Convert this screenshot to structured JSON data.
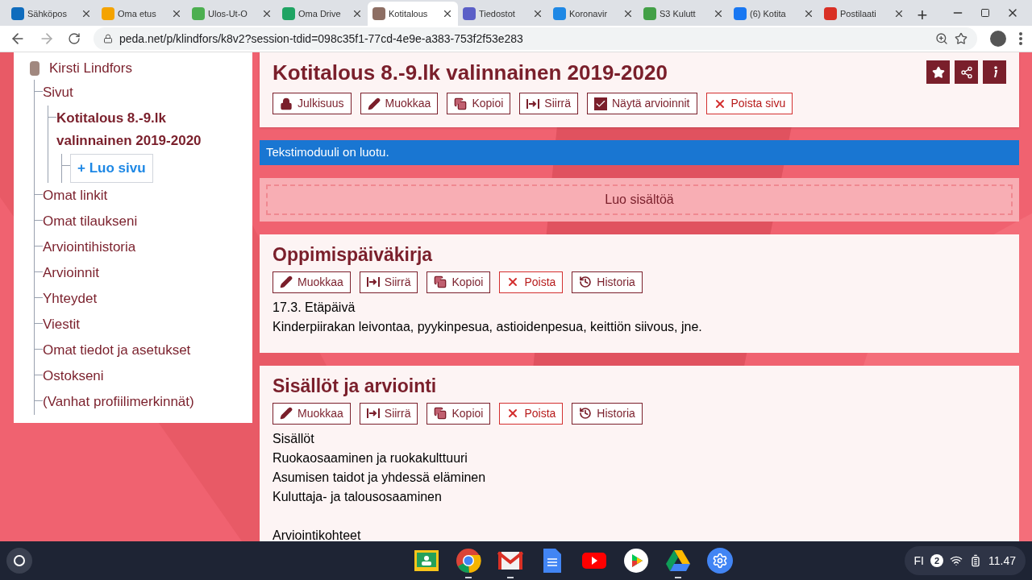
{
  "tabs": [
    {
      "title": "Sähköpos",
      "color": "#0f6cbd",
      "selected": false
    },
    {
      "title": "Oma etus",
      "color": "#f4a300",
      "selected": false
    },
    {
      "title": "Ulos-Ut-O",
      "color": "#4caf50",
      "selected": false
    },
    {
      "title": "Oma Drive",
      "color": "#1fa463",
      "selected": false
    },
    {
      "title": "Kotitalous",
      "color": "#8d6e63",
      "selected": true
    },
    {
      "title": "Tiedostot",
      "color": "#5b5fc7",
      "selected": false
    },
    {
      "title": "Koronavir",
      "color": "#1e88e5",
      "selected": false
    },
    {
      "title": "S3 Kulutt",
      "color": "#43a047",
      "selected": false
    },
    {
      "title": "(6) Kotita",
      "color": "#1877f2",
      "selected": false
    },
    {
      "title": "Postilaati",
      "color": "#d93025",
      "selected": false
    }
  ],
  "new_tab": "+",
  "address": "peda.net/p/klindfors/k8v2?session-tdid=098c35f1-77cd-4e9e-a383-753f2f53e283",
  "sidebar": {
    "user": "Kirsti Lindfors",
    "items": [
      {
        "kind": "link",
        "label": "Sivut",
        "selected": false,
        "children": [
          {
            "kind": "link",
            "label": "Kotitalous 8.-9.lk valinnainen 2019-2020",
            "selected": true,
            "children": [
              {
                "kind": "create",
                "label": "+ Luo sivu"
              }
            ]
          }
        ]
      },
      {
        "kind": "link",
        "label": "Omat linkit",
        "selected": false
      },
      {
        "kind": "link",
        "label": "Omat tilaukseni",
        "selected": false
      },
      {
        "kind": "link",
        "label": "Arviointihistoria",
        "selected": false
      },
      {
        "kind": "link",
        "label": "Arvioinnit",
        "selected": false
      },
      {
        "kind": "link",
        "label": "Yhteydet",
        "selected": false
      },
      {
        "kind": "link",
        "label": "Viestit",
        "selected": false
      },
      {
        "kind": "link",
        "label": "Omat tiedot ja asetukset",
        "selected": false
      },
      {
        "kind": "link",
        "label": "Ostokseni",
        "selected": false
      },
      {
        "kind": "link",
        "label": "(Vanhat profiilimerkinnät)",
        "selected": false
      }
    ]
  },
  "page": {
    "title": "Kotitalous 8.-9.lk valinnainen 2019-2020",
    "buttons": [
      {
        "kind": "publicity",
        "label": "Julkisuus"
      },
      {
        "kind": "edit",
        "label": "Muokkaa"
      },
      {
        "kind": "copy",
        "label": "Kopioi"
      },
      {
        "kind": "move",
        "label": "Siirrä"
      },
      {
        "kind": "toggle",
        "label": "Näytä arvioinnit",
        "checked": true
      },
      {
        "kind": "delete",
        "label": "Poista sivu"
      }
    ]
  },
  "notice": "Tekstimoduuli on luotu.",
  "create_content": "Luo sisältöä",
  "modules": [
    {
      "title": "Oppimispäiväkirja",
      "buttons": [
        {
          "kind": "edit",
          "label": "Muokkaa"
        },
        {
          "kind": "move",
          "label": "Siirrä"
        },
        {
          "kind": "copy",
          "label": "Kopioi"
        },
        {
          "kind": "delete",
          "label": "Poista"
        },
        {
          "kind": "history",
          "label": "Historia"
        }
      ],
      "lines": [
        "17.3. Etäpäivä",
        "Kinderpiirakan leivontaa, pyykinpesua, astioidenpesua, keittiön siivous, jne."
      ]
    },
    {
      "title": "Sisällöt ja arviointi",
      "buttons": [
        {
          "kind": "edit",
          "label": "Muokkaa"
        },
        {
          "kind": "move",
          "label": "Siirrä"
        },
        {
          "kind": "copy",
          "label": "Kopioi"
        },
        {
          "kind": "delete",
          "label": "Poista"
        },
        {
          "kind": "history",
          "label": "Historia"
        }
      ],
      "lines": [
        "Sisällöt",
        "Ruokaosaaminen ja ruokakulttuuri",
        "Asumisen taidot ja yhdessä eläminen",
        "Kuluttaja- ja talousosaaminen",
        "Arviointikohteet"
      ]
    }
  ],
  "shelf": {
    "apps": [
      {
        "kind": "classroom",
        "running": false
      },
      {
        "kind": "chrome",
        "running": true
      },
      {
        "kind": "gmail",
        "running": true
      },
      {
        "kind": "docs",
        "running": false
      },
      {
        "kind": "youtube",
        "running": false
      },
      {
        "kind": "play",
        "running": false
      },
      {
        "kind": "drive",
        "running": true
      },
      {
        "kind": "settings",
        "running": false
      }
    ],
    "language": "FI",
    "notifications": "2",
    "time": "11.47"
  }
}
